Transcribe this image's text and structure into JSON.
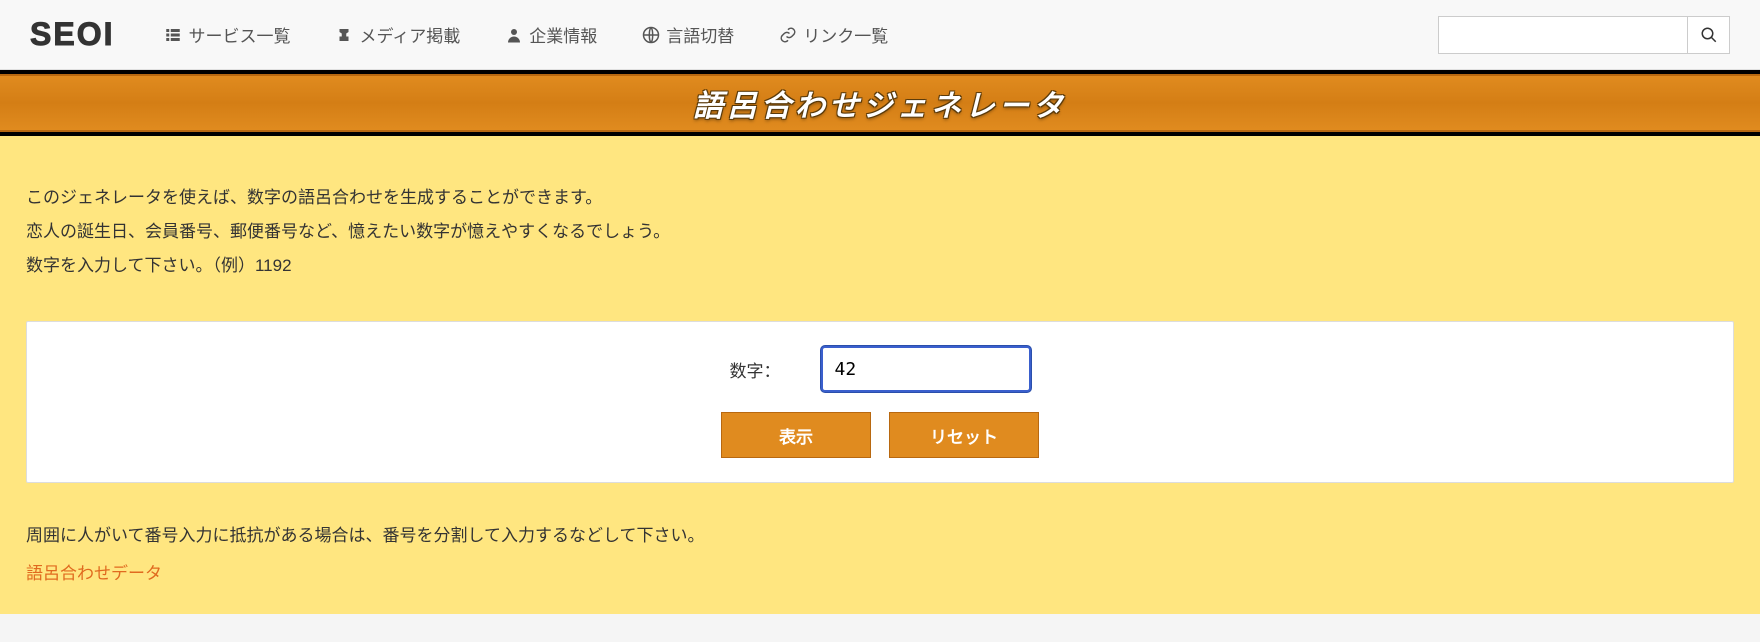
{
  "logo": "SEOI",
  "nav": {
    "services": "サービス一覧",
    "media": "メディア掲載",
    "company": "企業情報",
    "language": "言語切替",
    "links": "リンク一覧"
  },
  "search": {
    "value": ""
  },
  "banner": {
    "title": "語呂合わせジェネレータ"
  },
  "intro": {
    "line1": "このジェネレータを使えば、数字の語呂合わせを生成することができます。",
    "line2": "恋人の誕生日、会員番号、郵便番号など、憶えたい数字が憶えやすくなるでしょう。",
    "line3": "数字を入力して下さい。（例）1192"
  },
  "form": {
    "label": "数字：",
    "value": "42",
    "submit": "表示",
    "reset": "リセット"
  },
  "footer": {
    "note": "周囲に人がいて番号入力に抵抗がある場合は、番号を分割して入力するなどして下さい。",
    "link_label": "語呂合わせデータ"
  }
}
